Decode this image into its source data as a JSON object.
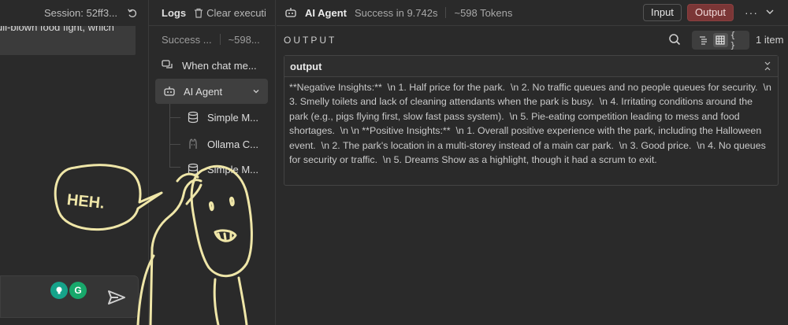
{
  "chat": {
    "session_label": "Session: 52ff3...",
    "message_text": "ull-blown food fight, which",
    "extension_g1": "",
    "extension_g2": "G"
  },
  "logs": {
    "title": "Logs",
    "clear_label": "Clear executi",
    "meta_status": "Success ...",
    "meta_tokens": "~598...",
    "items": [
      {
        "label": "When chat me...",
        "icon": "chat-icon"
      },
      {
        "label": "AI Agent",
        "icon": "robot-icon"
      },
      {
        "label": "Simple M...",
        "icon": "database-icon"
      },
      {
        "label": "Ollama C...",
        "icon": "ollama-icon"
      },
      {
        "label": "Simple M...",
        "icon": "database-icon"
      }
    ]
  },
  "main": {
    "agent_title": "AI Agent",
    "status": "Success in 9.742s",
    "tokens": "~598 Tokens",
    "input_tab": "Input",
    "output_tab": "Output",
    "section_label": "OUTPUT",
    "item_count": "1 item",
    "card_title": "output",
    "output_text": "**Negative Insights:**  \\n 1. Half price for the park.  \\n 2. No traffic queues and no people queues for security.  \\n 3. Smelly toilets and lack of cleaning attendants when the park is busy.  \\n 4. Irritating conditions around the park (e.g., pigs flying first, slow fast pass system).  \\n 5. Pie-eating competition leading to mess and food shortages.  \\n \\n **Positive Insights:**  \\n 1. Overall positive experience with the park, including the Halloween event.  \\n 2. The park's location in a multi-storey instead of a main car park.  \\n 3. Good price.  \\n 4. No queues for security or traffic.  \\n 5. Dreams Show as a highlight, though it had a scrum to exit."
  },
  "doodle": {
    "speech": "HEH."
  },
  "colors": {
    "output_active": "#7b3636",
    "doodle_stroke": "#efe6a8"
  }
}
